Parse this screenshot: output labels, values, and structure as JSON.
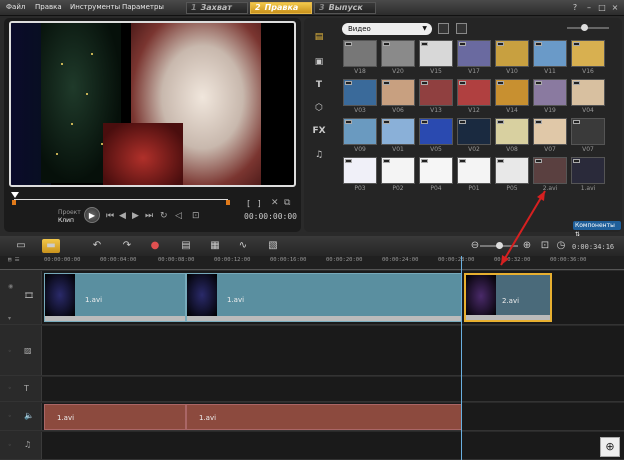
{
  "menu": {
    "items": [
      "Файл",
      "Правка",
      "Инструменты",
      "Параметры"
    ]
  },
  "steps": [
    {
      "num": "1",
      "label": "Захват"
    },
    {
      "num": "2",
      "label": "Правка"
    },
    {
      "num": "3",
      "label": "Выпуск"
    }
  ],
  "player": {
    "mode_project": "Проект",
    "mode_clip": "Клип",
    "timecode": "00:00:00:00",
    "in_bracket": "[",
    "out_bracket": "]"
  },
  "library": {
    "selected": "Видео",
    "thumbs": [
      {
        "label": "V18",
        "color": "#777"
      },
      {
        "label": "V20",
        "color": "#8a8a8a"
      },
      {
        "label": "V15",
        "color": "#d8d8d8"
      },
      {
        "label": "V17",
        "color": "#6a6aa0"
      },
      {
        "label": "V10",
        "color": "#c8a040"
      },
      {
        "label": "V11",
        "color": "#6a9ac8"
      },
      {
        "label": "V16",
        "color": "#d8b050"
      },
      {
        "label": "V03",
        "color": "#3a6a9a"
      },
      {
        "label": "V06",
        "color": "#c8a080"
      },
      {
        "label": "V13",
        "color": "#904040"
      },
      {
        "label": "V12",
        "color": "#b04040"
      },
      {
        "label": "V14",
        "color": "#c89030"
      },
      {
        "label": "V19",
        "color": "#8a7aa0"
      },
      {
        "label": "V04",
        "color": "#d8c0a0"
      },
      {
        "label": "V09",
        "color": "#6a9ac0"
      },
      {
        "label": "V01",
        "color": "#8ab0d8"
      },
      {
        "label": "V05",
        "color": "#2a4ab0"
      },
      {
        "label": "V02",
        "color": "#1a2a40"
      },
      {
        "label": "V08",
        "color": "#d8d0a0"
      },
      {
        "label": "V07",
        "color": "#e0c8a8"
      },
      {
        "label": "V07",
        "color": "#3a3a3a"
      },
      {
        "label": "P03",
        "color": "#f0f0f8"
      },
      {
        "label": "P02",
        "color": "#f4f4f4"
      },
      {
        "label": "P04",
        "color": "#f6f6f6"
      },
      {
        "label": "P01",
        "color": "#f4f4f4"
      },
      {
        "label": "P05",
        "color": "#e8e8e8"
      },
      {
        "label": "2.avi",
        "color": "#5a4040"
      },
      {
        "label": "1.avi",
        "color": "#2a2a3a"
      }
    ],
    "components_label": "Компоненты"
  },
  "timeline": {
    "timecode": "0:00:34:16",
    "ruler": [
      "00:00:00:00",
      "00:00:04:00",
      "00:00:08:00",
      "00:00:12:00",
      "00:00:16:00",
      "00:00:20:00",
      "00:00:24:00",
      "00:00:28:00",
      "00:00:32:00",
      "00:00:36:00"
    ],
    "video_clips": [
      "1.avi",
      "1.avi",
      "2.avi"
    ],
    "audio_clips": [
      "1.avi",
      "1.avi"
    ]
  },
  "colors": {
    "accent": "#e8b030",
    "clip_video": "#5a8fa0",
    "clip_audio": "#8c4a3e",
    "arrow": "#d62020"
  }
}
